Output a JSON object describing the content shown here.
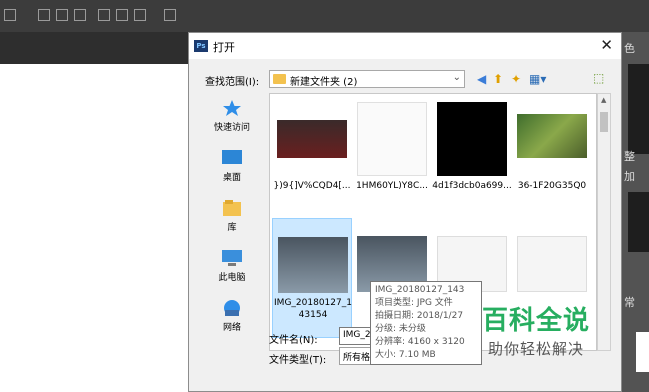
{
  "dialog": {
    "title": "打开",
    "lookin_label": "查找范围(I):",
    "current_folder": "新建文件夹 (2)",
    "places": [
      {
        "label": "快速访问"
      },
      {
        "label": "桌面"
      },
      {
        "label": "库"
      },
      {
        "label": "此电脑"
      },
      {
        "label": "网络"
      }
    ],
    "files": [
      {
        "name": "})9{]V%CQD4[..."
      },
      {
        "name": "1HM60YL)Y8C..."
      },
      {
        "name": "4d1f3dcb0a699..."
      },
      {
        "name": "36-1F20G35Q0"
      },
      {
        "name": "IMG_20180127_143154"
      },
      {
        "name": "IMG_"
      },
      {
        "name": ""
      },
      {
        "name": ""
      }
    ],
    "filename_label": "文件名(N):",
    "filename_value": "IMG_2018",
    "filetype_label": "文件类型(T):",
    "filetype_value": "所有格"
  },
  "tooltip": {
    "line1": "IMG_20180127_143",
    "line2": "项目类型: JPG 文件",
    "line3": "拍摄日期: 2018/1/27",
    "line4": "分级: 未分级",
    "line5": "分辨率: 4160 x 3120",
    "line6": "大小: 7.10 MB"
  },
  "watermark": {
    "main": "百科全说",
    "sub": "助你轻松解决"
  },
  "right_panel": {
    "t1": "色",
    "t2": "整",
    "t3": "加",
    "t4": "常"
  }
}
